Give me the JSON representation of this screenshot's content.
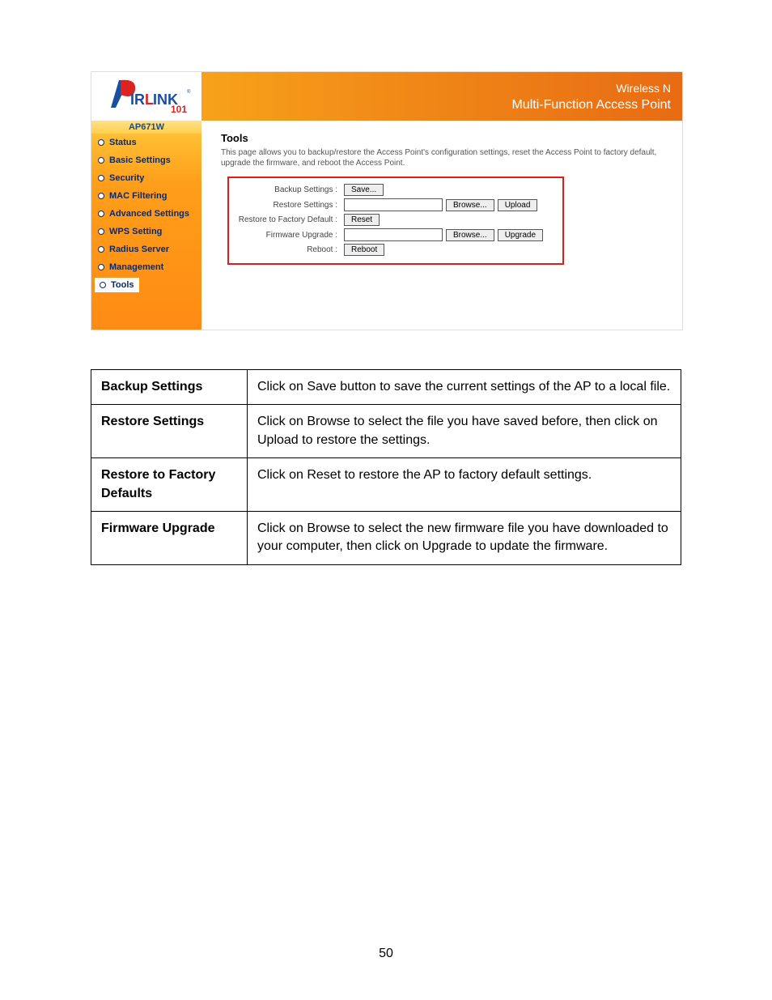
{
  "banner": {
    "line1": "Wireless N",
    "line2": "Multi-Function Access Point"
  },
  "logo": {
    "brand": "AirLink",
    "suffix": "101"
  },
  "model": "AP671W",
  "nav": [
    {
      "label": "Status"
    },
    {
      "label": "Basic Settings"
    },
    {
      "label": "Security"
    },
    {
      "label": "MAC Filtering"
    },
    {
      "label": "Advanced Settings"
    },
    {
      "label": "WPS Setting"
    },
    {
      "label": "Radius Server"
    },
    {
      "label": "Management"
    },
    {
      "label": "Tools"
    }
  ],
  "content": {
    "title": "Tools",
    "desc": "This page allows you to backup/restore the Access Point's configuration settings, reset the Access Point to factory default, upgrade the firmware, and reboot the Access Point.",
    "rows": {
      "backup_label": "Backup Settings :",
      "backup_btn": "Save...",
      "restore_label": "Restore Settings :",
      "restore_browse": "Browse...",
      "restore_upload": "Upload",
      "factory_label": "Restore to Factory Default :",
      "factory_btn": "Reset",
      "fw_label": "Firmware Upgrade :",
      "fw_browse": "Browse...",
      "fw_upgrade": "Upgrade",
      "reboot_label": "Reboot :",
      "reboot_btn": "Reboot"
    }
  },
  "table": [
    {
      "param": "Backup Settings",
      "desc": "Click on Save button to save the current settings of the AP to a local file."
    },
    {
      "param": "Restore Settings",
      "desc": "Click on Browse to select the file you have saved before, then click on Upload to restore the settings."
    },
    {
      "param": "Restore to Factory Defaults",
      "desc": "Click on Reset to restore the AP to factory default settings."
    },
    {
      "param": "Firmware Upgrade",
      "desc": "Click on Browse to select the new firmware file you have downloaded to your computer, then click on Upgrade to update the firmware."
    }
  ],
  "page_number": "50"
}
